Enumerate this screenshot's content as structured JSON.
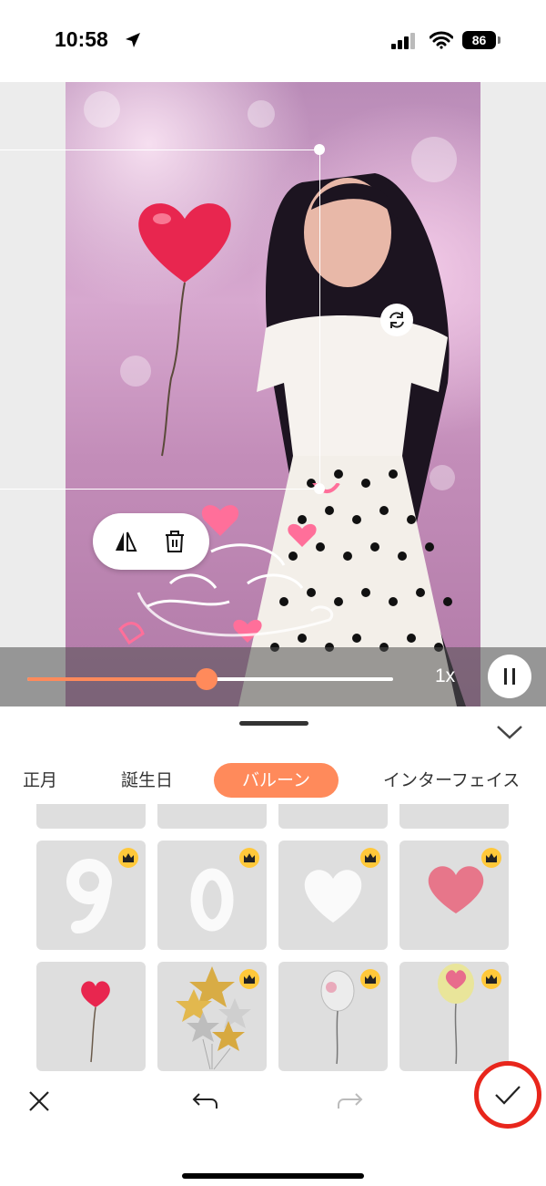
{
  "status_bar": {
    "time": "10:58",
    "battery": "86"
  },
  "editor": {
    "speed_label": "1x",
    "progress": 0.49
  },
  "categories": {
    "tabs": [
      {
        "label": "正月"
      },
      {
        "label": "誕生日"
      },
      {
        "label": "バルーン",
        "active": true
      },
      {
        "label": "インターフェイス"
      }
    ]
  },
  "stickers": [
    {
      "name": "balloon-number-9",
      "premium": true
    },
    {
      "name": "balloon-number-0",
      "premium": true
    },
    {
      "name": "white-heart-balloon",
      "premium": true
    },
    {
      "name": "pink-heart-balloon",
      "premium": true
    },
    {
      "name": "red-heart-balloon-on-string",
      "premium": false
    },
    {
      "name": "star-balloon-bundle",
      "premium": true
    },
    {
      "name": "clear-balloon",
      "premium": true
    },
    {
      "name": "yellow-printed-balloon",
      "premium": true
    }
  ],
  "colors": {
    "accent": "#ff8a5b",
    "confirm_ring": "#e8261c",
    "premium_badge": "#ffc83a"
  }
}
